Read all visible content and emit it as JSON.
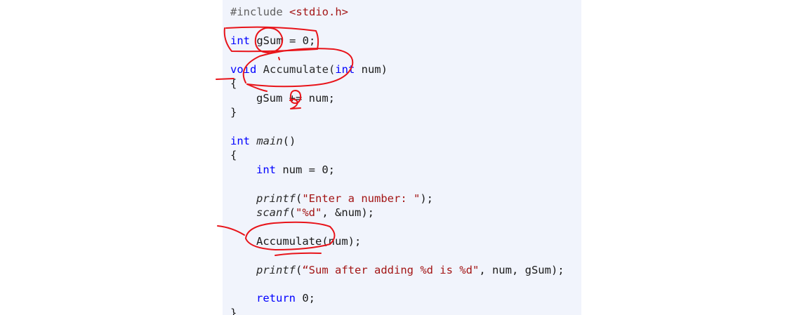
{
  "code": {
    "lines": [
      {
        "text": "#include <stdio.h>"
      },
      {
        "text": "int gSum = 0;"
      },
      {
        "text": "void Accumulate(int num)"
      },
      {
        "text": "{"
      },
      {
        "text": "gSum += num;"
      },
      {
        "text": "}"
      },
      {
        "text": "int main()"
      },
      {
        "text": "{"
      },
      {
        "text": "int num = 0;"
      },
      {
        "text": "printf(\"Enter a number: \");"
      },
      {
        "text": "scanf(\"%d\", &num);"
      },
      {
        "text": "Accumulate(num);"
      },
      {
        "text": "printf(“Sum after adding %d is %d\", num, gSum);"
      },
      {
        "text": "return 0;"
      },
      {
        "text": "}"
      }
    ],
    "tokens": {
      "l0": {
        "directive": "#include",
        "header": "<stdio.h>"
      },
      "l1": {
        "type": "int",
        "rest": " gSum = 0;"
      },
      "l2": {
        "type": "void",
        "fname": " Accumulate(",
        "ptype": "int",
        "pname": " num)"
      },
      "l3": {
        "brace": "{"
      },
      "l4": {
        "text": "gSum += num;"
      },
      "l5": {
        "brace": "}"
      },
      "l6": {
        "type": "int",
        "fname": "main",
        "rest": "()"
      },
      "l7": {
        "brace": "{"
      },
      "l8": {
        "type": "int",
        "rest": " num = 0;"
      },
      "l9": {
        "fname": "printf",
        "open": "(",
        "str": "\"Enter a number: \"",
        "close": ");"
      },
      "l10": {
        "fname": "scanf",
        "open": "(",
        "str": "\"%d\"",
        "close": ", &num);"
      },
      "l11": {
        "text": "Accumulate(num);"
      },
      "l12": {
        "fname": "printf",
        "open": "(",
        "str": "“Sum after adding %d is %d\"",
        "close": ", num, gSum);"
      },
      "l13": {
        "kw": "return",
        "rest": " 0;"
      },
      "l14": {
        "brace": "}"
      }
    }
  },
  "annotations": {
    "ink_color": "#e8141a",
    "handwritten_number": "2",
    "marks": [
      "circle-gSum",
      "box-int-gSum",
      "circle-accumulate-decl",
      "circle-plus-operator",
      "circle-accumulate-call"
    ]
  },
  "colors": {
    "panel_bg": "#f1f4fc",
    "keyword": "#0000ff",
    "string": "#a31515",
    "directive": "#616161"
  }
}
